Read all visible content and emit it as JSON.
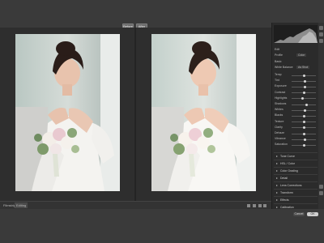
{
  "toolbar": {
    "before_label": "Before",
    "after_label": "After"
  },
  "bottom_tabs": [
    "Filmstrip",
    "Editing"
  ],
  "panel": {
    "title": "Edit",
    "profile_label": "Profile",
    "profile_value": "Color",
    "basic_label": "Basic",
    "wb_label": "White Balance",
    "wb_value": "As Shot",
    "sliders": [
      {
        "label": "Temp",
        "value": 0.52
      },
      {
        "label": "Tint",
        "value": 0.55
      },
      {
        "label": "Exposure",
        "value": 0.55
      },
      {
        "label": "Contrast",
        "value": 0.5
      },
      {
        "label": "Highlights",
        "value": 0.45
      },
      {
        "label": "Shadows",
        "value": 0.6
      },
      {
        "label": "Whites",
        "value": 0.55
      },
      {
        "label": "Blacks",
        "value": 0.5
      },
      {
        "label": "Texture",
        "value": 0.5
      },
      {
        "label": "Clarity",
        "value": 0.52
      },
      {
        "label": "Dehaze",
        "value": 0.5
      },
      {
        "label": "Vibrance",
        "value": 0.55
      },
      {
        "label": "Saturation",
        "value": 0.5
      }
    ],
    "sections": [
      "Tone Curve",
      "HSL / Color",
      "Color Grading",
      "Detail",
      "Lens Corrections",
      "Transform",
      "Effects",
      "Calibration"
    ]
  },
  "footer": {
    "cancel_label": "Cancel",
    "ok_label": "OK"
  },
  "colors": {
    "accent": "#9a9a9a",
    "background": "#3a3a3a",
    "panel": "#2b2b2b"
  }
}
